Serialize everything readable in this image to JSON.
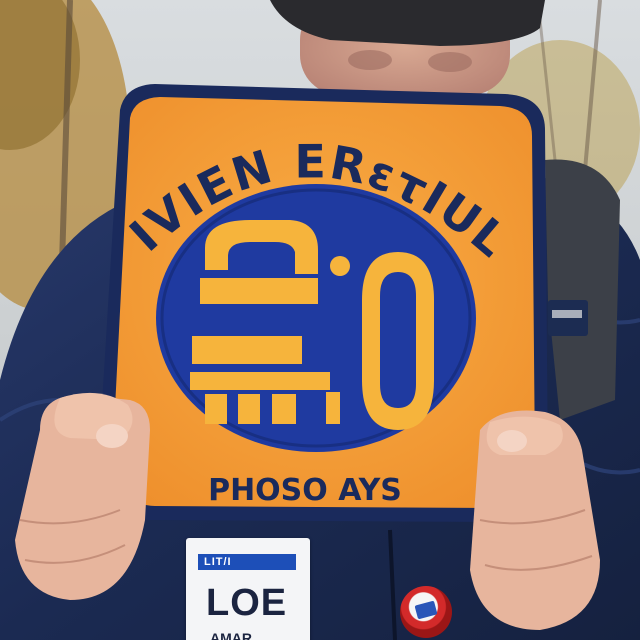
{
  "sign": {
    "arc_text": "IVIEN ERετIUL",
    "numeral_a": "□",
    "numeral_b": ".0",
    "bottom_text": "PHOSO AYS"
  },
  "badge": {
    "stripe_text": "LIT/I",
    "name": "LOE",
    "sub": "AMAR"
  },
  "colors": {
    "sign_orange": "#f5a03c",
    "sign_navy": "#1a2a5c",
    "circle_blue": "#1f3aa0",
    "numeral_yellow": "#f6b43c",
    "jacket_navy": "#1c2c52",
    "skin": "#e9b99c"
  }
}
